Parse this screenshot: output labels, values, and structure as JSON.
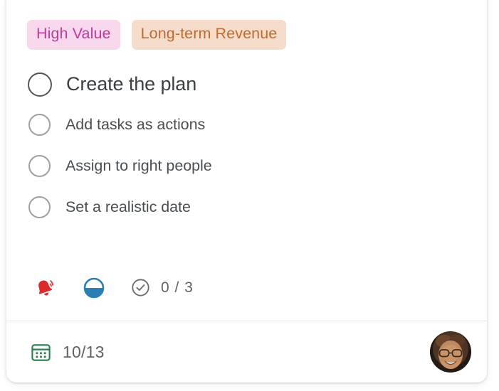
{
  "card": {
    "tags": [
      {
        "label": "High Value",
        "bg": "#f9d8ed",
        "color": "#bf3a9e",
        "name": "tag-high-value"
      },
      {
        "label": "Long-term Revenue",
        "bg": "#f6ddcb",
        "color": "#c46a2e",
        "name": "tag-long-term-revenue"
      }
    ],
    "checklist": [
      {
        "label": "Create the plan",
        "checked": false,
        "level": "primary"
      },
      {
        "label": "Add tasks as actions",
        "checked": false,
        "level": "sub"
      },
      {
        "label": "Assign to right people",
        "checked": false,
        "level": "sub"
      },
      {
        "label": "Set a realistic date",
        "checked": false,
        "level": "sub"
      }
    ],
    "meta": {
      "reminder_icon": "bell-ringing-icon",
      "reminder_color": "#d92b2b",
      "progress_icon": "half-filled-circle-icon",
      "progress_color": "#2a7fb5",
      "checklist_icon": "check-circle-icon",
      "checklist_icon_color": "#6b6b6b",
      "checklist_count": "0 / 3"
    },
    "footer": {
      "date_icon": "calendar-icon",
      "date_icon_color": "#2e7d4f",
      "date": "10/13",
      "avatar_icon": "user-avatar-photo"
    }
  }
}
